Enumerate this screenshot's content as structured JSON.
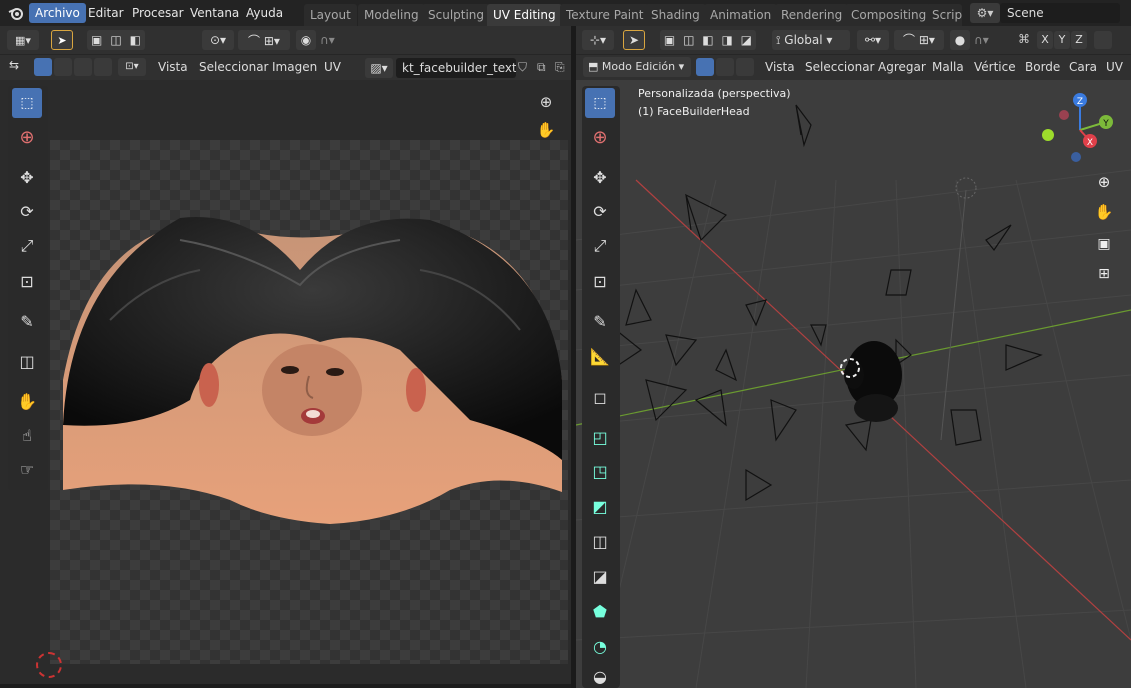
{
  "topbar": {
    "menus": [
      "Archivo",
      "Editar",
      "Procesar",
      "Ventana",
      "Ayuda"
    ],
    "workspaces": [
      "Layout",
      "Modeling",
      "Sculpting",
      "UV Editing",
      "Texture Paint",
      "Shading",
      "Animation",
      "Rendering",
      "Compositing",
      "Scripti"
    ],
    "active_workspace": "UV Editing",
    "scene_name": "Scene"
  },
  "uv_editor": {
    "menus": [
      "Vista",
      "Seleccionar",
      "Imagen",
      "UV"
    ],
    "image_name": "kt_facebuilder_textu..."
  },
  "viewport": {
    "orientation": "Global",
    "mode": "Modo Edición",
    "menus": [
      "Vista",
      "Seleccionar",
      "Agregar",
      "Malla",
      "Vértice",
      "Borde",
      "Cara",
      "UV"
    ],
    "axes": [
      "X",
      "Y",
      "Z"
    ],
    "view_name": "Personalizada (perspectiva)",
    "object_name": "(1) FaceBuilderHead",
    "gizmo": {
      "x": "X",
      "y": "Y",
      "z": "Z"
    }
  },
  "colors": {
    "accent": "#4772b3",
    "x_axis": "#e0404a",
    "y_axis": "#7cba3a",
    "z_axis": "#3a7be0"
  }
}
